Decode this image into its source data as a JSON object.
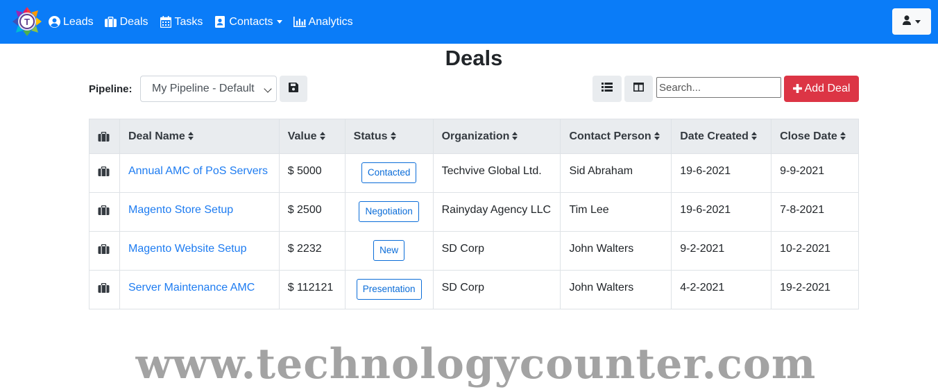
{
  "nav": {
    "items": [
      {
        "label": "Leads",
        "icon": "user-circle-icon"
      },
      {
        "label": "Deals",
        "icon": "briefcase-icon"
      },
      {
        "label": "Tasks",
        "icon": "calendar-icon"
      },
      {
        "label": "Contacts",
        "icon": "address-card-icon",
        "dropdown": true
      },
      {
        "label": "Analytics",
        "icon": "bar-chart-icon"
      }
    ],
    "user_menu_icon": "user-icon"
  },
  "page": {
    "title": "Deals"
  },
  "toolbar": {
    "pipeline_label": "Pipeline:",
    "pipeline_value": "My Pipeline - Default",
    "search_placeholder": "Search...",
    "add_label": "Add Deal"
  },
  "table": {
    "headers": [
      "Deal Name",
      "Value",
      "Status",
      "Organization",
      "Contact Person",
      "Date Created",
      "Close Date"
    ],
    "rows": [
      {
        "name": "Annual AMC of PoS Servers",
        "value": "$ 5000",
        "status": "Contacted",
        "organization": "Techvive Global Ltd.",
        "contact": "Sid Abraham",
        "created": "19-6-2021",
        "close": "9-9-2021"
      },
      {
        "name": "Magento Store Setup",
        "value": "$ 2500",
        "status": "Negotiation",
        "organization": "Rainyday Agency LLC",
        "contact": "Tim Lee",
        "created": "19-6-2021",
        "close": "7-8-2021"
      },
      {
        "name": "Magento Website Setup",
        "value": "$ 2232",
        "status": "New",
        "organization": "SD Corp",
        "contact": "John Walters",
        "created": "9-2-2021",
        "close": "10-2-2021"
      },
      {
        "name": "Server Maintenance AMC",
        "value": "$ 112121",
        "status": "Presentation",
        "organization": "SD Corp",
        "contact": "John Walters",
        "created": "4-2-2021",
        "close": "19-2-2021"
      }
    ]
  },
  "watermark": "www.technologycounter.com",
  "colors": {
    "navbar": "#0a7cf8",
    "link": "#1e7cf1",
    "add_button": "#dc3545",
    "badge": "#0a6cd8"
  }
}
